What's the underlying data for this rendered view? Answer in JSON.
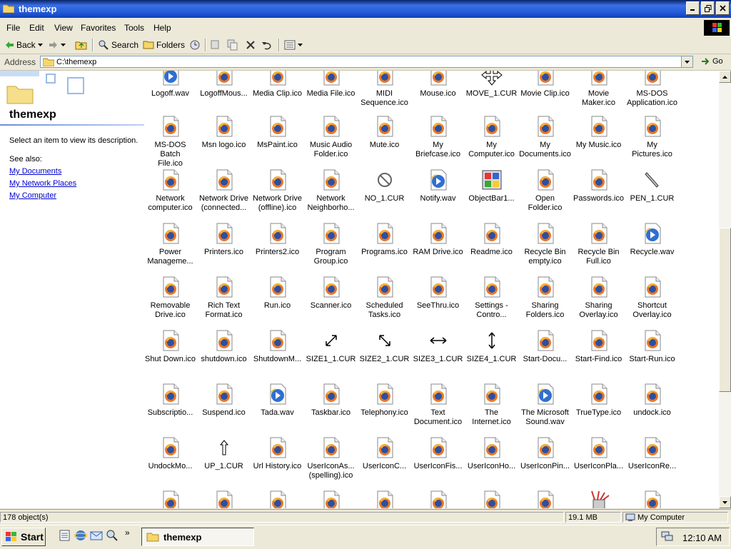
{
  "window": {
    "title": "themexp"
  },
  "menu": [
    "File",
    "Edit",
    "View",
    "Favorites",
    "Tools",
    "Help"
  ],
  "toolbar": {
    "back": "Back",
    "search": "Search",
    "folders": "Folders"
  },
  "address": {
    "label": "Address",
    "value": "C:\\themexp",
    "go": "Go"
  },
  "left_pane": {
    "title": "themexp",
    "description": "Select an item to view its description.",
    "see_also": "See also:",
    "links": [
      "My Documents",
      "My Network Places",
      "My Computer"
    ]
  },
  "items": [
    {
      "label": "Logoff.wav",
      "icon": "wav"
    },
    {
      "label": "LogoffMous...",
      "icon": "ico"
    },
    {
      "label": "Media Clip.ico",
      "icon": "ico"
    },
    {
      "label": "Media File.ico",
      "icon": "ico"
    },
    {
      "label": "MIDI\nSequence.ico",
      "icon": "ico"
    },
    {
      "label": "Mouse.ico",
      "icon": "ico"
    },
    {
      "label": "MOVE_1.CUR",
      "icon": "cur-move"
    },
    {
      "label": "Movie Clip.ico",
      "icon": "ico"
    },
    {
      "label": "Movie\nMaker.ico",
      "icon": "ico"
    },
    {
      "label": "MS-DOS\nApplication.ico",
      "icon": "ico"
    },
    {
      "label": "MS-DOS Batch\nFile.ico",
      "icon": "ico"
    },
    {
      "label": "Msn logo.ico",
      "icon": "ico"
    },
    {
      "label": "MsPaint.ico",
      "icon": "ico"
    },
    {
      "label": "Music Audio\nFolder.ico",
      "icon": "ico"
    },
    {
      "label": "Mute.ico",
      "icon": "ico"
    },
    {
      "label": "My\nBriefcase.ico",
      "icon": "ico"
    },
    {
      "label": "My\nComputer.ico",
      "icon": "ico"
    },
    {
      "label": "My\nDocuments.ico",
      "icon": "ico"
    },
    {
      "label": "My Music.ico",
      "icon": "ico"
    },
    {
      "label": "My\nPictures.ico",
      "icon": "ico"
    },
    {
      "label": "Network\ncomputer.ico",
      "icon": "ico"
    },
    {
      "label": "Network Drive\n(connected...",
      "icon": "ico"
    },
    {
      "label": "Network Drive\n(offline).ico",
      "icon": "ico"
    },
    {
      "label": "Network\nNeighborho...",
      "icon": "ico"
    },
    {
      "label": "NO_1.CUR",
      "icon": "cur-no"
    },
    {
      "label": "Notify.wav",
      "icon": "wav"
    },
    {
      "label": "ObjectBar1...",
      "icon": "objbar"
    },
    {
      "label": "Open\nFolder.ico",
      "icon": "ico"
    },
    {
      "label": "Passwords.ico",
      "icon": "ico"
    },
    {
      "label": "PEN_1.CUR",
      "icon": "cur-pen"
    },
    {
      "label": "Power\nManageme...",
      "icon": "ico"
    },
    {
      "label": "Printers.ico",
      "icon": "ico"
    },
    {
      "label": "Printers2.ico",
      "icon": "ico"
    },
    {
      "label": "Program\nGroup.ico",
      "icon": "ico"
    },
    {
      "label": "Programs.ico",
      "icon": "ico"
    },
    {
      "label": "RAM Drive.ico",
      "icon": "ico"
    },
    {
      "label": "Readme.ico",
      "icon": "ico"
    },
    {
      "label": "Recycle Bin\nempty.ico",
      "icon": "ico"
    },
    {
      "label": "Recycle Bin\nFull.ico",
      "icon": "ico"
    },
    {
      "label": "Recycle.wav",
      "icon": "wav"
    },
    {
      "label": "Removable\nDrive.ico",
      "icon": "ico"
    },
    {
      "label": "Rich Text\nFormat.ico",
      "icon": "ico"
    },
    {
      "label": "Run.ico",
      "icon": "ico"
    },
    {
      "label": "Scanner.ico",
      "icon": "ico"
    },
    {
      "label": "Scheduled\nTasks.ico",
      "icon": "ico"
    },
    {
      "label": "SeeThru.ico",
      "icon": "ico"
    },
    {
      "label": "Settings -\nContro...",
      "icon": "ico"
    },
    {
      "label": "Sharing\nFolders.ico",
      "icon": "ico"
    },
    {
      "label": "Sharing\nOverlay.ico",
      "icon": "ico"
    },
    {
      "label": "Shortcut\nOverlay.ico",
      "icon": "ico"
    },
    {
      "label": "Shut Down.ico",
      "icon": "ico"
    },
    {
      "label": "shutdown.ico",
      "icon": "ico"
    },
    {
      "label": "ShutdownM...",
      "icon": "ico"
    },
    {
      "label": "SIZE1_1.CUR",
      "icon": "cur-size1"
    },
    {
      "label": "SIZE2_1.CUR",
      "icon": "cur-size2"
    },
    {
      "label": "SIZE3_1.CUR",
      "icon": "cur-size3"
    },
    {
      "label": "SIZE4_1.CUR",
      "icon": "cur-size4"
    },
    {
      "label": "Start-Docu...",
      "icon": "ico"
    },
    {
      "label": "Start-Find.ico",
      "icon": "ico"
    },
    {
      "label": "Start-Run.ico",
      "icon": "ico"
    },
    {
      "label": "Subscriptio...",
      "icon": "ico"
    },
    {
      "label": "Suspend.ico",
      "icon": "ico"
    },
    {
      "label": "Tada.wav",
      "icon": "wav"
    },
    {
      "label": "Taskbar.ico",
      "icon": "ico"
    },
    {
      "label": "Telephony.ico",
      "icon": "ico"
    },
    {
      "label": "Text\nDocument.ico",
      "icon": "ico"
    },
    {
      "label": "The\nInternet.ico",
      "icon": "ico"
    },
    {
      "label": "The Microsoft\nSound.wav",
      "icon": "wav"
    },
    {
      "label": "TrueType.ico",
      "icon": "ico"
    },
    {
      "label": "undock.ico",
      "icon": "ico"
    },
    {
      "label": "UndockMo...",
      "icon": "ico"
    },
    {
      "label": "UP_1.CUR",
      "icon": "cur-up"
    },
    {
      "label": "Url History.ico",
      "icon": "ico"
    },
    {
      "label": "UserIconAs...\n(spelling).ico",
      "icon": "ico"
    },
    {
      "label": "UserIconC...",
      "icon": "ico"
    },
    {
      "label": "UserIconFis...",
      "icon": "ico"
    },
    {
      "label": "UserIconHo...",
      "icon": "ico"
    },
    {
      "label": "UserIconPin...",
      "icon": "ico"
    },
    {
      "label": "UserIconPla...",
      "icon": "ico"
    },
    {
      "label": "UserIconRe...",
      "icon": "ico"
    },
    {
      "label": "",
      "icon": "ico"
    },
    {
      "label": "",
      "icon": "ico"
    },
    {
      "label": "",
      "icon": "ico"
    },
    {
      "label": "",
      "icon": "ico"
    },
    {
      "label": "",
      "icon": "ico"
    },
    {
      "label": "",
      "icon": "ico"
    },
    {
      "label": "",
      "icon": "ico"
    },
    {
      "label": "",
      "icon": "ico"
    },
    {
      "label": "",
      "icon": "pens"
    },
    {
      "label": "",
      "icon": "ico"
    }
  ],
  "status": {
    "objects": "178 object(s)",
    "size": "19.1 MB",
    "zone": "My Computer"
  },
  "taskbar": {
    "start": "Start",
    "task": "themexp",
    "clock": "12:10 AM"
  }
}
